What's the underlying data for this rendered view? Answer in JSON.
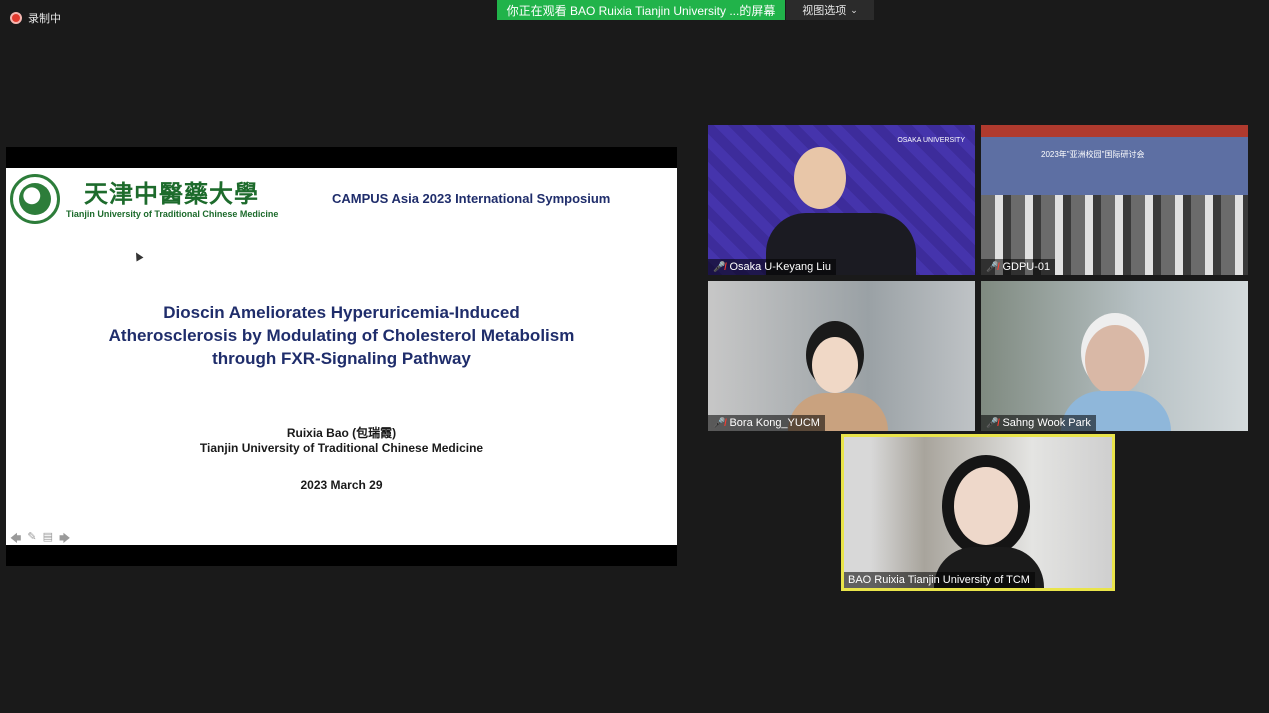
{
  "recording": {
    "label": "录制中"
  },
  "share_banner": {
    "text": "你正在观看 BAO  Ruixia  Tianjin  University  ...的屏幕"
  },
  "view_options": {
    "label": "视图选项",
    "chevron_icon": "chevron-down-icon"
  },
  "slide": {
    "univ_name_cn": "天津中醫藥大學",
    "univ_name_en": "Tianjin University of Traditional Chinese Medicine",
    "symposium": "CAMPUS Asia 2023 International Symposium",
    "title_line1": "Dioscin Ameliorates Hyperuricemia-Induced",
    "title_line2": "Atherosclerosis by Modulating of Cholesterol Metabolism",
    "title_line3": "through FXR-Signaling Pathway",
    "author": "Ruixia Bao (包瑞霞)",
    "affiliation": "Tianjin University of Traditional Chinese Medicine",
    "date": "2023 March 29"
  },
  "tiles": [
    {
      "name": "Osaka U-Keyang Liu",
      "muted": true,
      "logo": "OSAKA UNIVERSITY"
    },
    {
      "name": "GDPU-01",
      "muted": true,
      "banner": "2023年\"亚洲校园\"国际研讨会"
    },
    {
      "name": "Bora Kong_YUCM",
      "muted": true
    },
    {
      "name": "Sahng Wook Park",
      "muted": true
    },
    {
      "name": "BAO  Ruixia  Tianjin University of TCM",
      "muted": false,
      "active_speaker": true
    }
  ],
  "colors": {
    "share_banner": "#21b34a",
    "active_speaker_border": "#e9e44a",
    "mic_off": "#ff3b30"
  }
}
